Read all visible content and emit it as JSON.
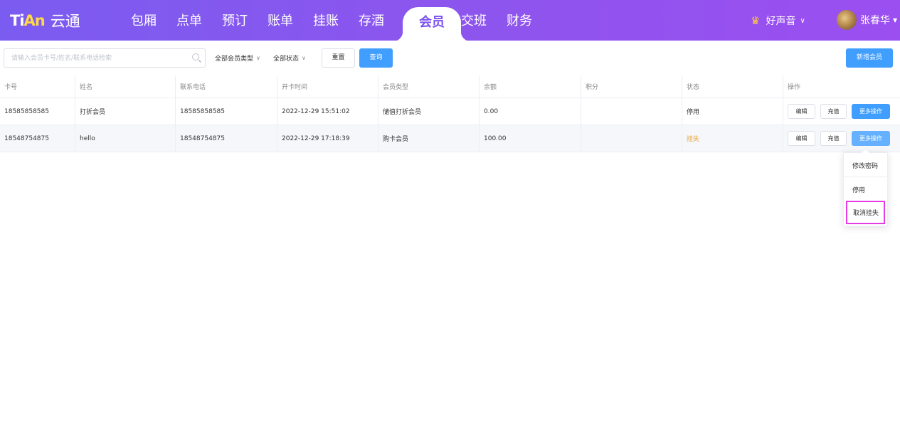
{
  "app": {
    "logo_mark_a": "Ti",
    "logo_mark_b": "An",
    "name": "云通"
  },
  "nav": {
    "items": [
      "包厢",
      "点单",
      "预订",
      "账单",
      "挂账",
      "存酒",
      "会员",
      "交班",
      "财务"
    ],
    "active": "会员"
  },
  "store": {
    "name": "好声音",
    "icon": "crown-icon"
  },
  "user": {
    "name": "张春华",
    "icon": "avatar"
  },
  "toolbar": {
    "search_placeholder": "请输入会员卡号/姓名/联系电话检索",
    "search_value": "",
    "member_type_select": "全部会员类型",
    "status_select": "全部状态",
    "reset_label": "重置",
    "query_label": "查询",
    "new_member_label": "新增会员"
  },
  "table": {
    "columns": [
      "卡号",
      "姓名",
      "联系电话",
      "开卡时间",
      "会员类型",
      "余额",
      "积分",
      "状态",
      "操作"
    ],
    "rows": [
      {
        "card_no": "18585858585",
        "name": "打折会员",
        "phone": "18585858585",
        "open_time": "2022-12-29 15:51:02",
        "member_type": "储值打折会员",
        "balance": "0.00",
        "points": "",
        "status": "停用",
        "actions": [
          "编辑",
          "充值",
          "更多操作"
        ]
      },
      {
        "card_no": "18548754875",
        "name": "hello",
        "phone": "18548754875",
        "open_time": "2022-12-29 17:18:39",
        "member_type": "购卡会员",
        "balance": "100.00",
        "points": "",
        "status": "挂失",
        "actions": [
          "编辑",
          "充值",
          "更多操作"
        ]
      }
    ]
  },
  "more_menu": {
    "items": [
      "修改密码",
      "停用",
      "取消挂失"
    ],
    "highlighted": "取消挂失"
  },
  "colors": {
    "header_start": "#7b5cf0",
    "header_end": "#9b4ff0",
    "primary": "#409eff",
    "warning": "#e6a23c",
    "highlight_border": "#e63be6"
  }
}
